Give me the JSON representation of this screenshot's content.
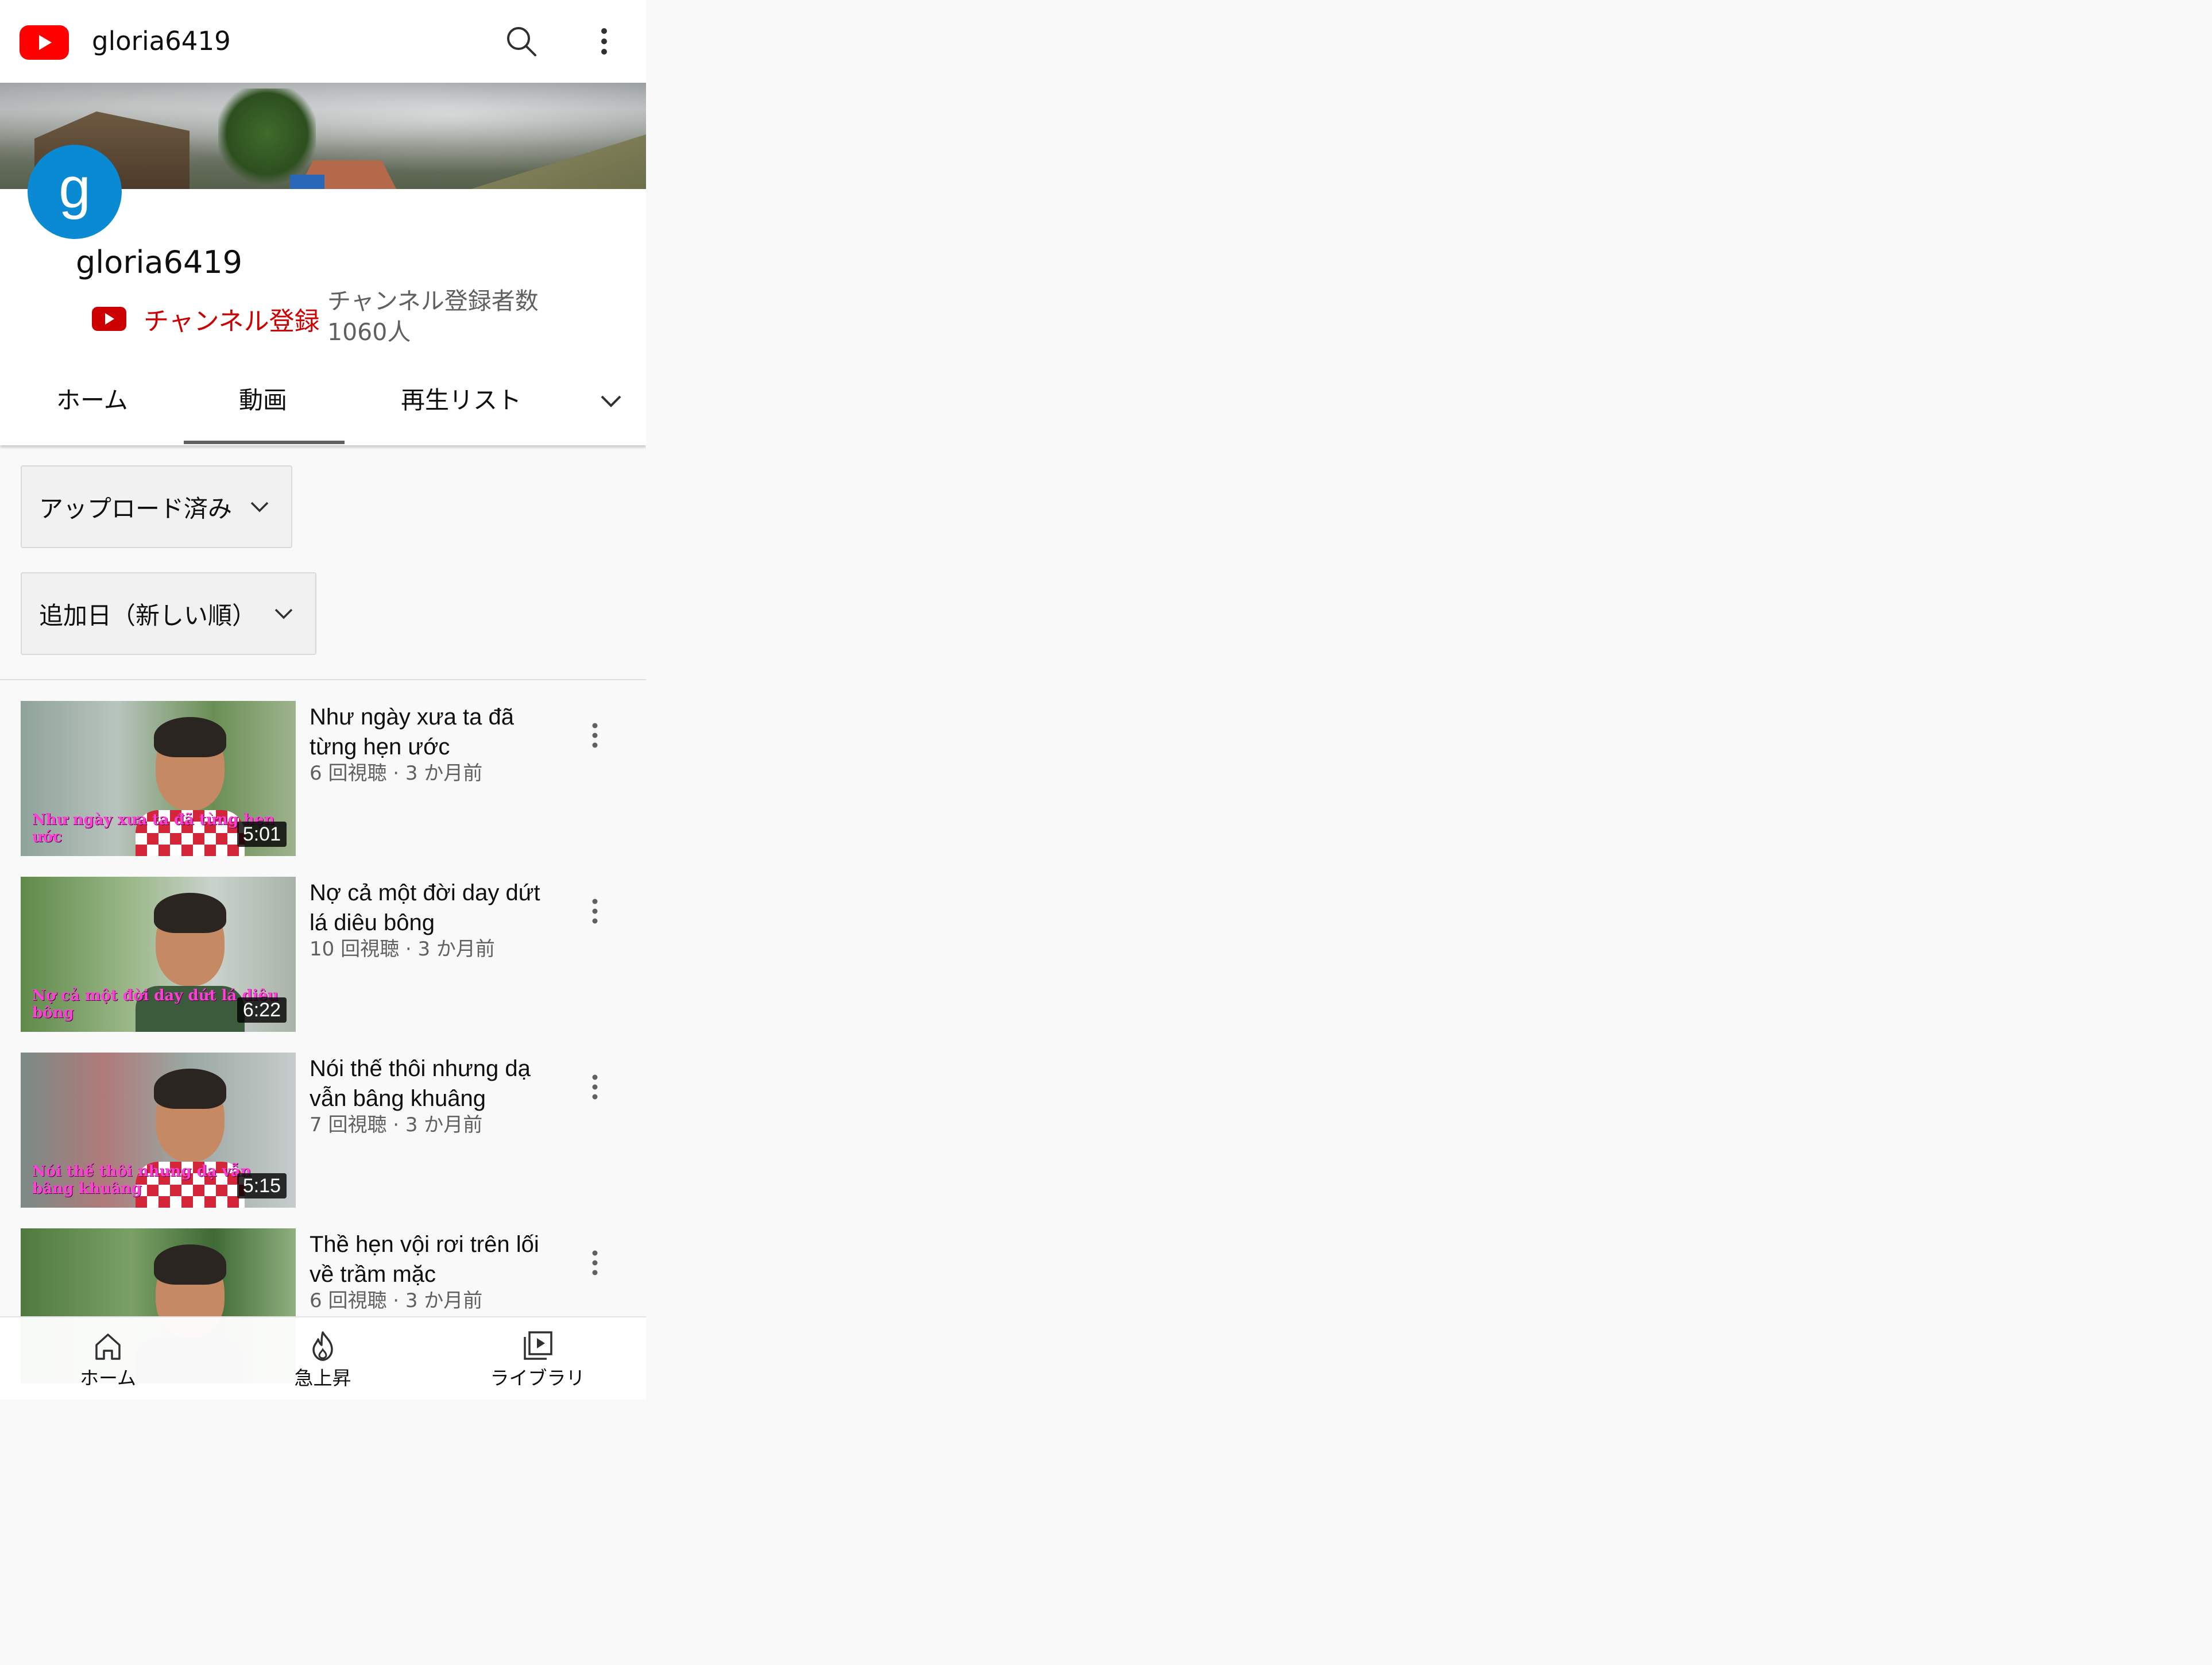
{
  "topbar": {
    "title": "gloria6419",
    "icons": [
      "youtube-logo-icon",
      "search-icon",
      "more-vert-icon"
    ]
  },
  "channel": {
    "avatar_letter": "g",
    "name": "gloria6419",
    "subscribe_label": "チャンネル登録",
    "subscriber_count_label": "チャンネル登録者数",
    "subscriber_count_value": "1060人"
  },
  "tabs": {
    "items": [
      {
        "label": "ホーム"
      },
      {
        "label": "動画"
      },
      {
        "label": "再生リスト"
      }
    ],
    "selected": "動画"
  },
  "filters": {
    "upload": "アップロード済み",
    "sort": "追加日（新しい順）"
  },
  "videos": [
    {
      "title": "Như ngày xưa ta đã từng hẹn ước",
      "meta": "6 回視聴 · 3 か月前",
      "duration": "5:01",
      "thumb_text": "Như ngày xưa ta đã từng hẹn ước"
    },
    {
      "title": "Nợ cả một đời day dứt lá diêu bông",
      "meta": "10 回視聴 · 3 か月前",
      "duration": "6:22",
      "thumb_text": "Nợ cả một đời day dứt lá diêu bông"
    },
    {
      "title": "Nói thế thôi nhưng dạ vẫn bâng khuâng",
      "meta": "7 回視聴 · 3 か月前",
      "duration": "5:15",
      "thumb_text": "Nói thế thôi nhưng dạ vẫn bâng khuâng"
    },
    {
      "title": "Thề hẹn vội rơi trên lối về trầm mặc",
      "meta": "6 回視聴 · 3 か月前",
      "duration": ""
    }
  ],
  "bottom_nav": {
    "home": "ホーム",
    "trending": "急上昇",
    "library": "ライブラリ"
  },
  "colors": {
    "brand_red": "#ff0000",
    "subscribe_red": "#cc0000",
    "avatar_blue": "#0b8ad4",
    "thumb_overlay_text": "#ff3fd6"
  }
}
